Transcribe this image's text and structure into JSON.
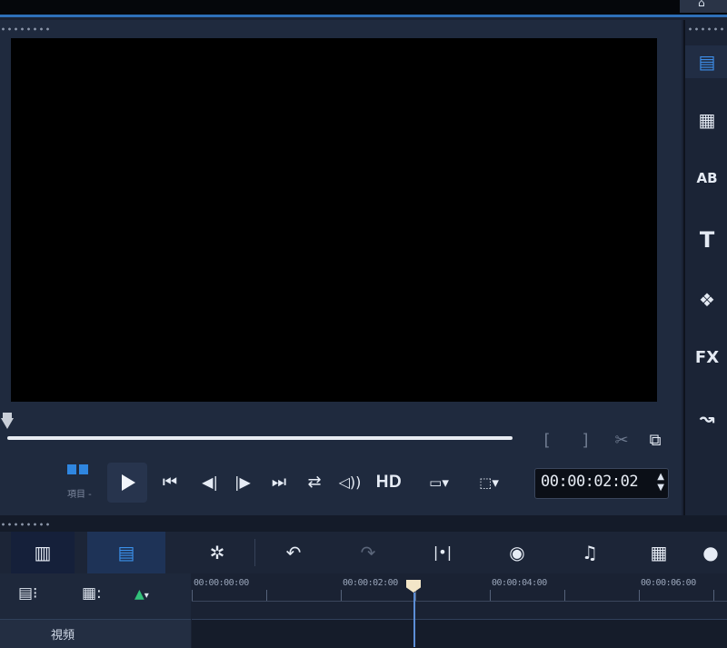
{
  "window": {
    "corner_icon": "home-icon"
  },
  "preview": {
    "mode_label": "項目 -",
    "controls": [
      {
        "name": "go-start-button",
        "glyph": "⏮"
      },
      {
        "name": "prev-frame-button",
        "glyph": "◀|"
      },
      {
        "name": "next-frame-button",
        "glyph": "|▶"
      },
      {
        "name": "go-end-button",
        "glyph": "⏭"
      },
      {
        "name": "repeat-button",
        "glyph": "⇄"
      },
      {
        "name": "volume-button",
        "glyph": "🔊"
      }
    ],
    "hd_label": "HD",
    "timecode": "00:00:02:02",
    "mark_in": "[",
    "mark_out": "]",
    "accent_color": "#2f86e0"
  },
  "library": {
    "items": [
      {
        "name": "media",
        "label": ""
      },
      {
        "name": "instant-project",
        "label": ""
      },
      {
        "name": "transition",
        "label": "AB"
      },
      {
        "name": "title",
        "label": "T"
      },
      {
        "name": "graphic",
        "label": ""
      },
      {
        "name": "filter",
        "label": "FX"
      },
      {
        "name": "path",
        "label": ""
      }
    ]
  },
  "timeline": {
    "ruler": [
      "00:00:00:00",
      "00:00:02:00",
      "00:00:04:00",
      "00:00:06:00"
    ],
    "track_label": "視頻"
  }
}
